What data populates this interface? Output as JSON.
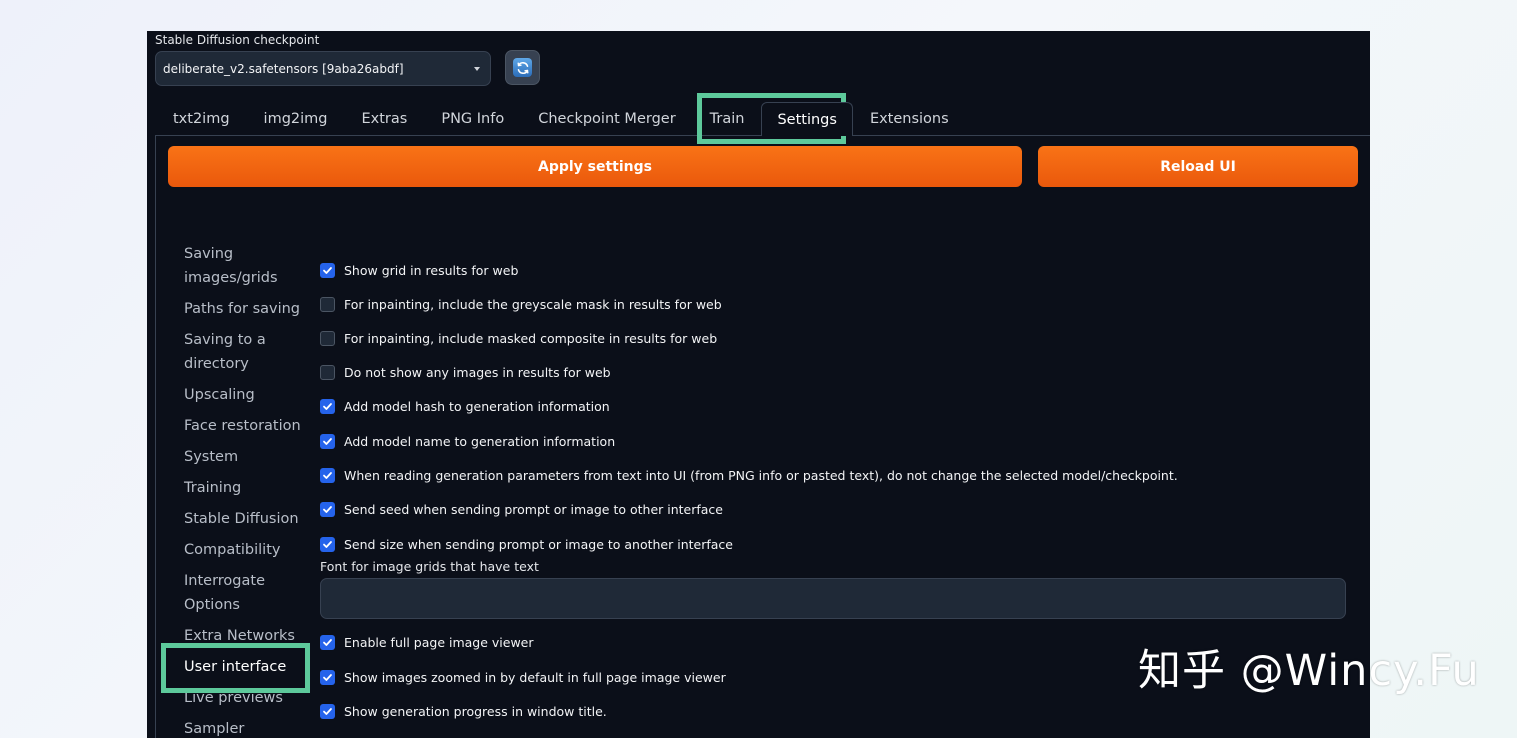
{
  "checkpoint": {
    "label": "Stable Diffusion checkpoint",
    "value": "deliberate_v2.safetensors [9aba26abdf]",
    "refresh_icon": "refresh-icon"
  },
  "tabs": [
    {
      "label": "txt2img"
    },
    {
      "label": "img2img"
    },
    {
      "label": "Extras"
    },
    {
      "label": "PNG Info"
    },
    {
      "label": "Checkpoint Merger"
    },
    {
      "label": "Train"
    },
    {
      "label": "Settings",
      "active": true
    },
    {
      "label": "Extensions"
    }
  ],
  "buttons": {
    "apply": "Apply settings",
    "reload": "Reload UI"
  },
  "sidebar": {
    "items": [
      {
        "label": "Saving images/grids"
      },
      {
        "label": "Paths for saving"
      },
      {
        "label": "Saving to a directory"
      },
      {
        "label": "Upscaling"
      },
      {
        "label": "Face restoration"
      },
      {
        "label": "System"
      },
      {
        "label": "Training"
      },
      {
        "label": "Stable Diffusion"
      },
      {
        "label": "Compatibility"
      },
      {
        "label": "Interrogate Options"
      },
      {
        "label": "Extra Networks"
      },
      {
        "label": "User interface",
        "active": true
      },
      {
        "label": "Live previews"
      },
      {
        "label": "Sampler"
      }
    ]
  },
  "options": [
    {
      "label": "Show grid in results for web",
      "checked": true
    },
    {
      "label": "For inpainting, include the greyscale mask in results for web",
      "checked": false
    },
    {
      "label": "For inpainting, include masked composite in results for web",
      "checked": false
    },
    {
      "label": "Do not show any images in results for web",
      "checked": false
    },
    {
      "label": "Add model hash to generation information",
      "checked": true
    },
    {
      "label": "Add model name to generation information",
      "checked": true
    },
    {
      "label": "When reading generation parameters from text into UI (from PNG info or pasted text), do not change the selected model/checkpoint.",
      "checked": true
    },
    {
      "label": "Send seed when sending prompt or image to other interface",
      "checked": true
    },
    {
      "label": "Send size when sending prompt or image to another interface",
      "checked": true
    }
  ],
  "font_field": {
    "label": "Font for image grids that have text",
    "value": ""
  },
  "options_after": [
    {
      "label": "Enable full page image viewer",
      "checked": true
    },
    {
      "label": "Show images zoomed in by default in full page image viewer",
      "checked": true
    },
    {
      "label": "Show generation progress in window title.",
      "checked": true
    }
  ],
  "watermark": "知乎 @Wincy.Fu",
  "colors": {
    "background": "#0b0f19",
    "accent_orange": "#f97316",
    "checkbox_blue": "#2563eb",
    "highlight_green": "#5dc99b"
  }
}
